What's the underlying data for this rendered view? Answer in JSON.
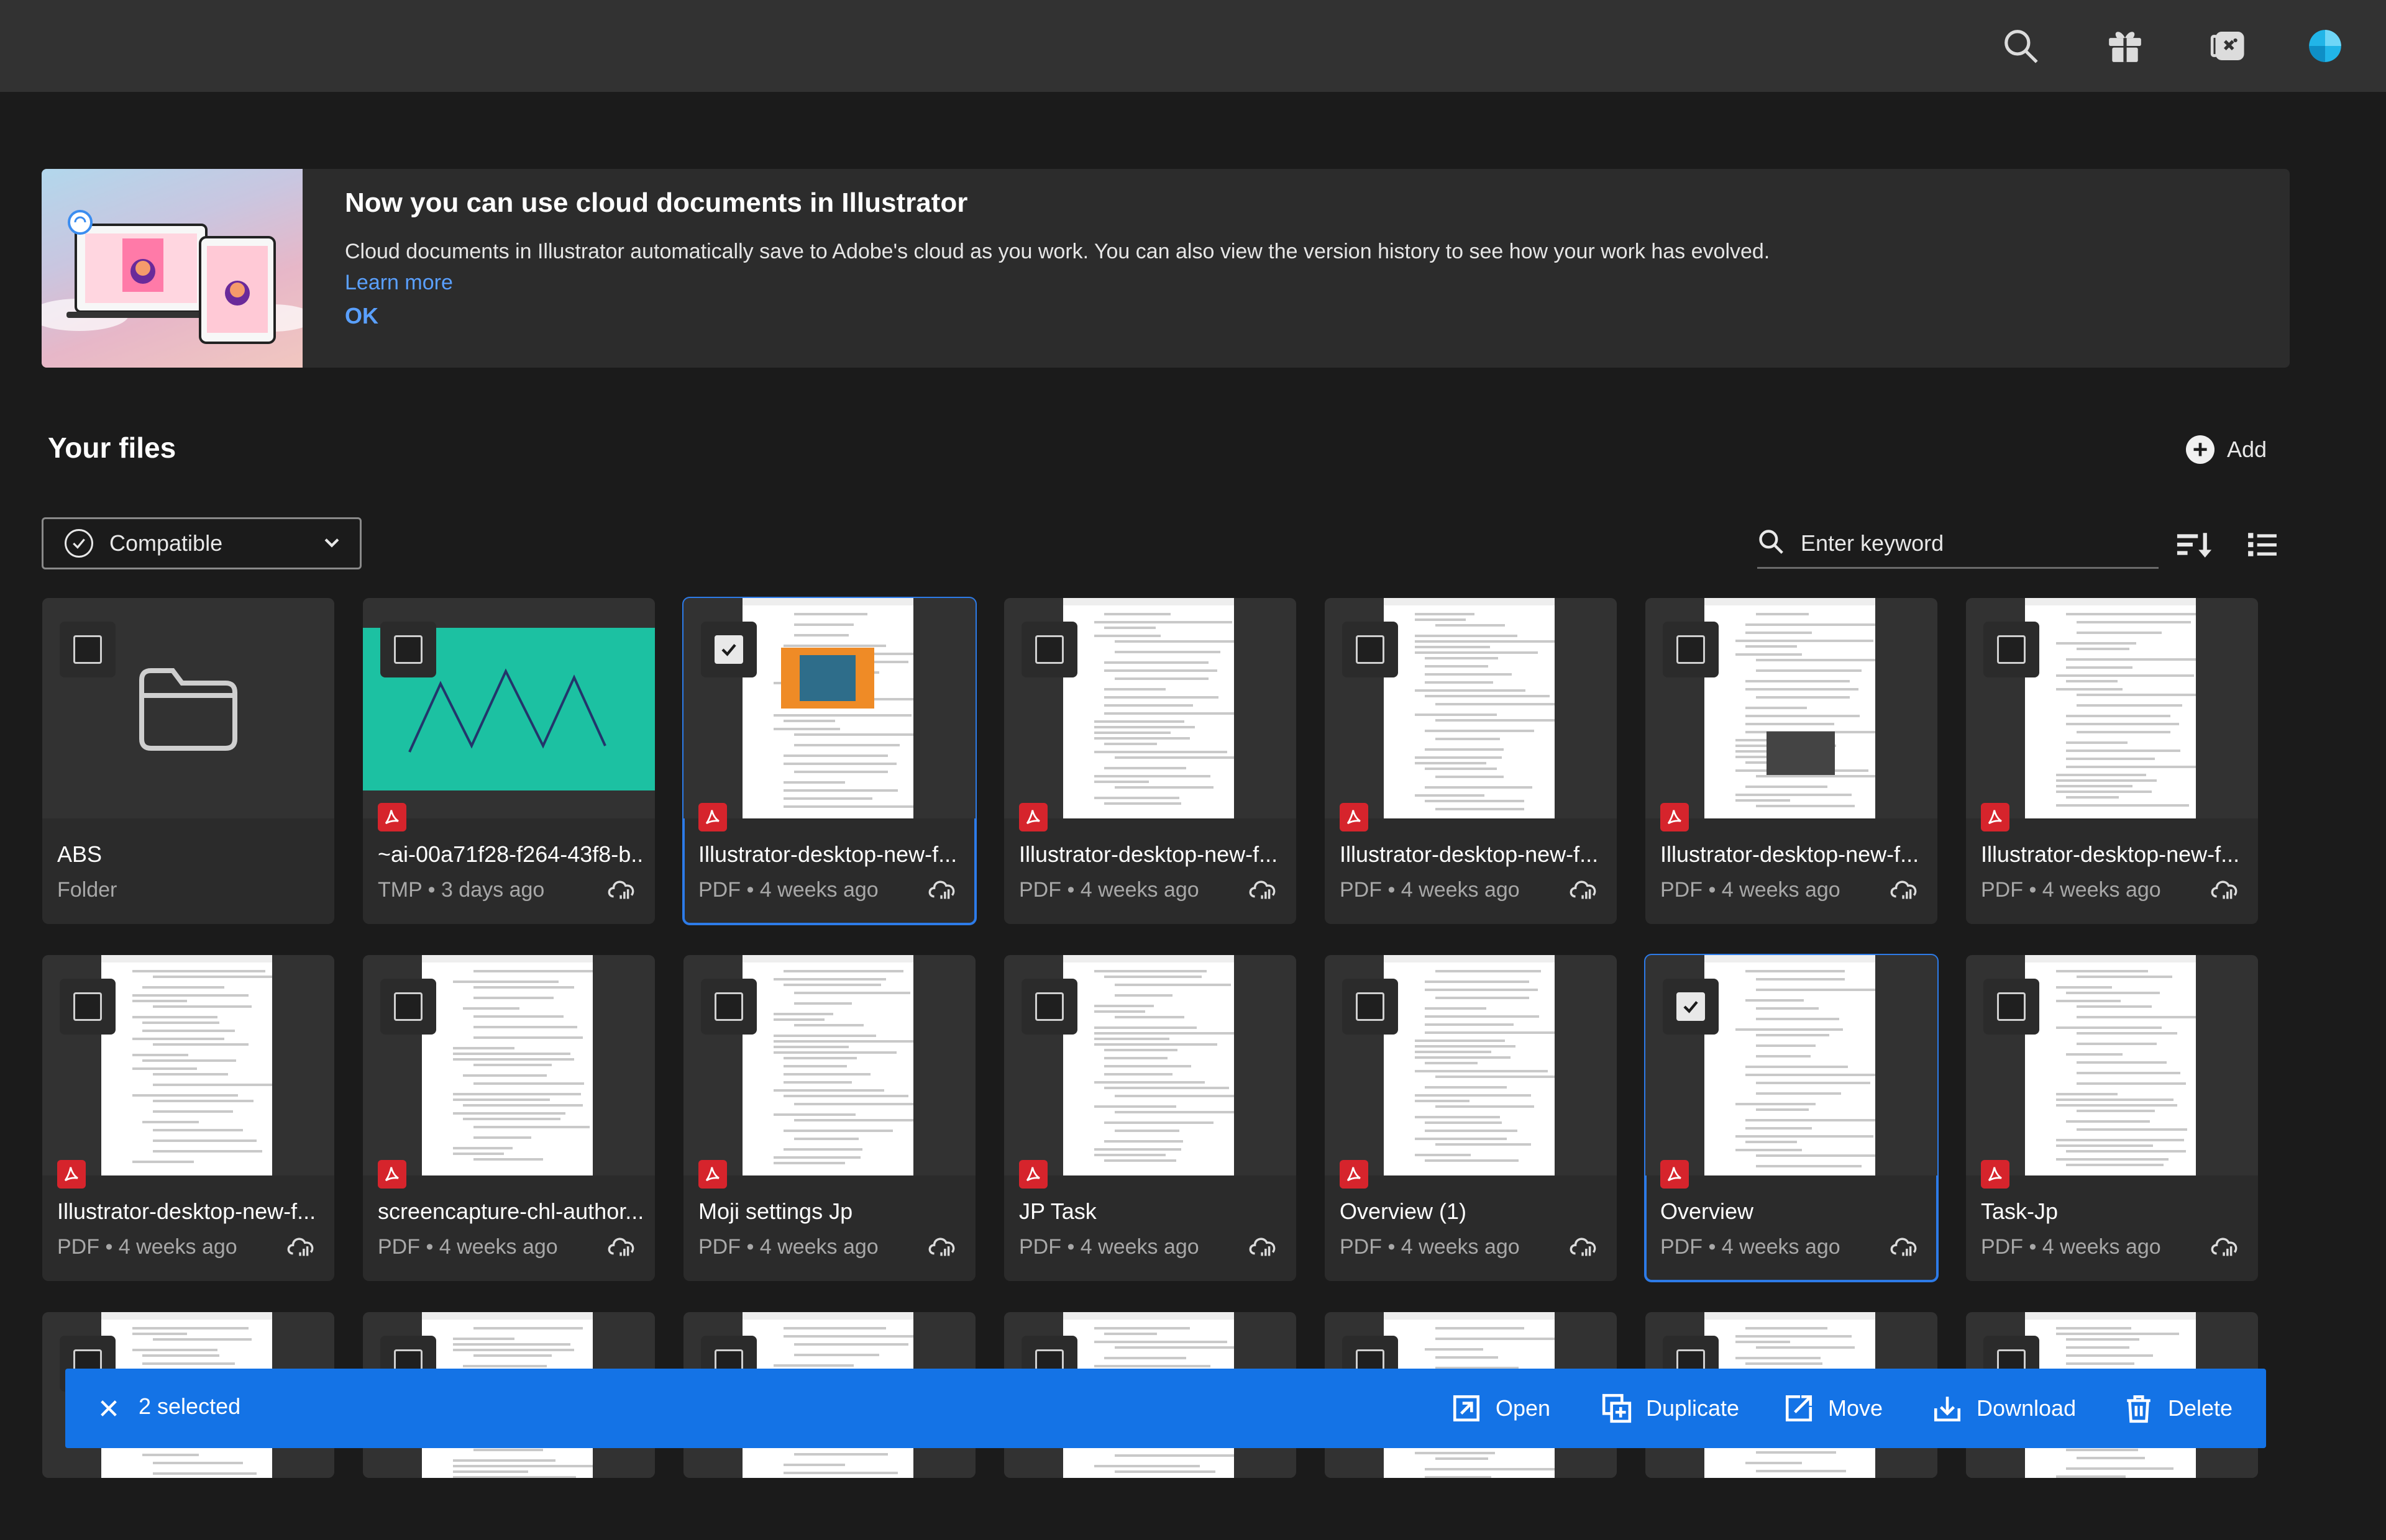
{
  "topbar": {
    "icons": [
      "search-icon",
      "gift-icon",
      "plugins-icon",
      "avatar"
    ]
  },
  "banner": {
    "title": "Now you can use cloud documents in Illustrator",
    "description": "Cloud documents in Illustrator automatically save to Adobe's cloud as you work. You can also view the version history to see how your work has evolved.",
    "learn_more": "Learn more",
    "ok": "OK"
  },
  "files": {
    "title": "Your files",
    "add_label": "Add",
    "filter_label": "Compatible",
    "search_placeholder": "Enter keyword",
    "items": [
      {
        "name": "ABS",
        "meta": "Folder",
        "type": "folder",
        "selected": false
      },
      {
        "name": "~ai-00a71f28-f264-43f8-b...",
        "meta": "TMP • 3 days ago",
        "type": "tmp",
        "selected": false
      },
      {
        "name": "Illustrator-desktop-new-f...",
        "meta": "PDF • 4 weeks ago",
        "type": "pdf",
        "selected": true
      },
      {
        "name": "Illustrator-desktop-new-f...",
        "meta": "PDF • 4 weeks ago",
        "type": "pdf",
        "selected": false
      },
      {
        "name": "Illustrator-desktop-new-f...",
        "meta": "PDF • 4 weeks ago",
        "type": "pdf",
        "selected": false
      },
      {
        "name": "Illustrator-desktop-new-f...",
        "meta": "PDF • 4 weeks ago",
        "type": "pdf",
        "selected": false
      },
      {
        "name": "Illustrator-desktop-new-f...",
        "meta": "PDF • 4 weeks ago",
        "type": "pdf",
        "selected": false
      },
      {
        "name": "Illustrator-desktop-new-f...",
        "meta": "PDF • 4 weeks ago",
        "type": "pdf",
        "selected": false
      },
      {
        "name": "screencapture-chl-author...",
        "meta": "PDF • 4 weeks ago",
        "type": "pdf",
        "selected": false
      },
      {
        "name": "Moji settings Jp",
        "meta": "PDF • 4 weeks ago",
        "type": "pdf",
        "selected": false
      },
      {
        "name": "JP Task",
        "meta": "PDF • 4 weeks ago",
        "type": "pdf",
        "selected": false
      },
      {
        "name": "Overview (1)",
        "meta": "PDF • 4 weeks ago",
        "type": "pdf",
        "selected": false
      },
      {
        "name": "Overview",
        "meta": "PDF • 4 weeks ago",
        "type": "pdf",
        "selected": true
      },
      {
        "name": "Task-Jp",
        "meta": "PDF • 4 weeks ago",
        "type": "pdf",
        "selected": false
      }
    ]
  },
  "action_bar": {
    "count": "2 selected",
    "open": "Open",
    "duplicate": "Duplicate",
    "move": "Move",
    "download": "Download",
    "delete": "Delete"
  },
  "colors": {
    "accent": "#1473e6",
    "link": "#5aa0ff",
    "pdf_red": "#d6242c",
    "teal_thumb": "#1cc1a2"
  }
}
